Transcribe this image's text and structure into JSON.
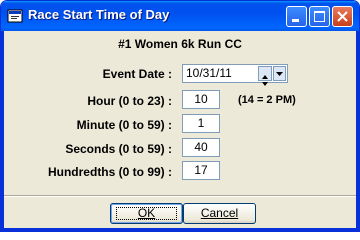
{
  "window": {
    "title": "Race Start Time of Day",
    "controls": {
      "minimize_icon": "minimize-icon",
      "maximize_icon": "maximize-icon",
      "close_icon": "close-icon"
    }
  },
  "heading": "#1 Women 6k Run CC",
  "fields": {
    "event_date": {
      "label": "Event Date :",
      "value": "10/31/11"
    },
    "hour": {
      "label": "Hour (0 to 23) :",
      "value": "10",
      "note": "(14 = 2 PM)"
    },
    "minute": {
      "label": "Minute (0 to 59) :",
      "value": "1"
    },
    "seconds": {
      "label": "Seconds (0 to 59) :",
      "value": "40"
    },
    "hundredths": {
      "label": "Hundredths (0 to 99) :",
      "value": "17"
    }
  },
  "buttons": {
    "ok": "OK",
    "cancel": "Cancel"
  },
  "colors": {
    "titlebar": "#0054e3",
    "dialog_bg": "#ece9d8",
    "close_btn": "#c8401c"
  }
}
